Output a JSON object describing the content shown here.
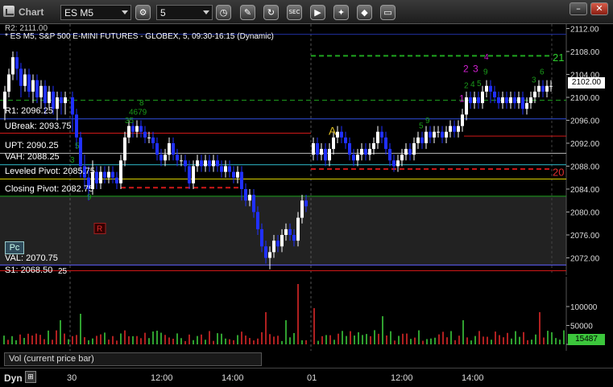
{
  "window": {
    "title": "Chart",
    "symbol": "ES M5",
    "interval": "5",
    "minimize": "–",
    "close": "✕",
    "toolbar_icons": [
      "settings-gear-icon",
      "clock-icon",
      "pencil-icon",
      "refresh-icon",
      "sec-icon",
      "play-icon",
      "settings-icon",
      "chat-icon"
    ]
  },
  "chart": {
    "title": "* ES M5, S&P 500 E-MINI FUTURES - GLOBEX, 5, 09:30-16:15 (Dynamic)",
    "r2_label": "R2: 2111.00",
    "price_ticks": [
      "2112.00",
      "2108.00",
      "2104.00",
      "2100.00",
      "2096.00",
      "2092.00",
      "2088.00",
      "2084.00",
      "2080.00",
      "2076.00",
      "2072.00"
    ],
    "current_price": "2102.00",
    "levels": [
      {
        "label": "R1: 2096.25"
      },
      {
        "label": "UBreak: 2093.75"
      },
      {
        "label": "UPT: 2090.25"
      },
      {
        "label": "VAH: 2088.25"
      },
      {
        "label": "Leveled Pivot: 2085.75"
      },
      {
        "label": "Closing Pivot: 2082.75"
      },
      {
        "label": "VAL: 2070.75"
      },
      {
        "label": "S1: 2068.50"
      }
    ],
    "annotations": {
      "a_marker": "A",
      "count_21": "21",
      "count_20": "20",
      "count_25": "25",
      "r_marker": "R",
      "pc_badge": "Pc",
      "pink_labels": [
        "1",
        "2",
        "3",
        "4"
      ],
      "green_seq_left": [
        "3",
        "5",
        "8",
        "9",
        "4679",
        "35",
        "8"
      ],
      "green_seq_right": [
        "5",
        "9",
        "6",
        "3",
        "2",
        "4",
        "5",
        "6",
        "9"
      ]
    },
    "colors": {
      "up_bar": "#ffffff",
      "down_bar": "#2030ff",
      "resistance_red": "#d01818",
      "support_green": "#1fa51f",
      "pivot_yellow": "#d8d000",
      "vah_cyan": "#30c0d0",
      "navy_band": "#2030a0"
    }
  },
  "volume": {
    "panel_label": "Vol (current price bar)",
    "ticks": [
      "100000",
      "50000",
      "0"
    ],
    "current_volume": "15487"
  },
  "time_axis": {
    "mode": "Dyn",
    "labels": [
      "30",
      "12:00",
      "14:00",
      "01",
      "12:00",
      "14:00"
    ]
  }
}
